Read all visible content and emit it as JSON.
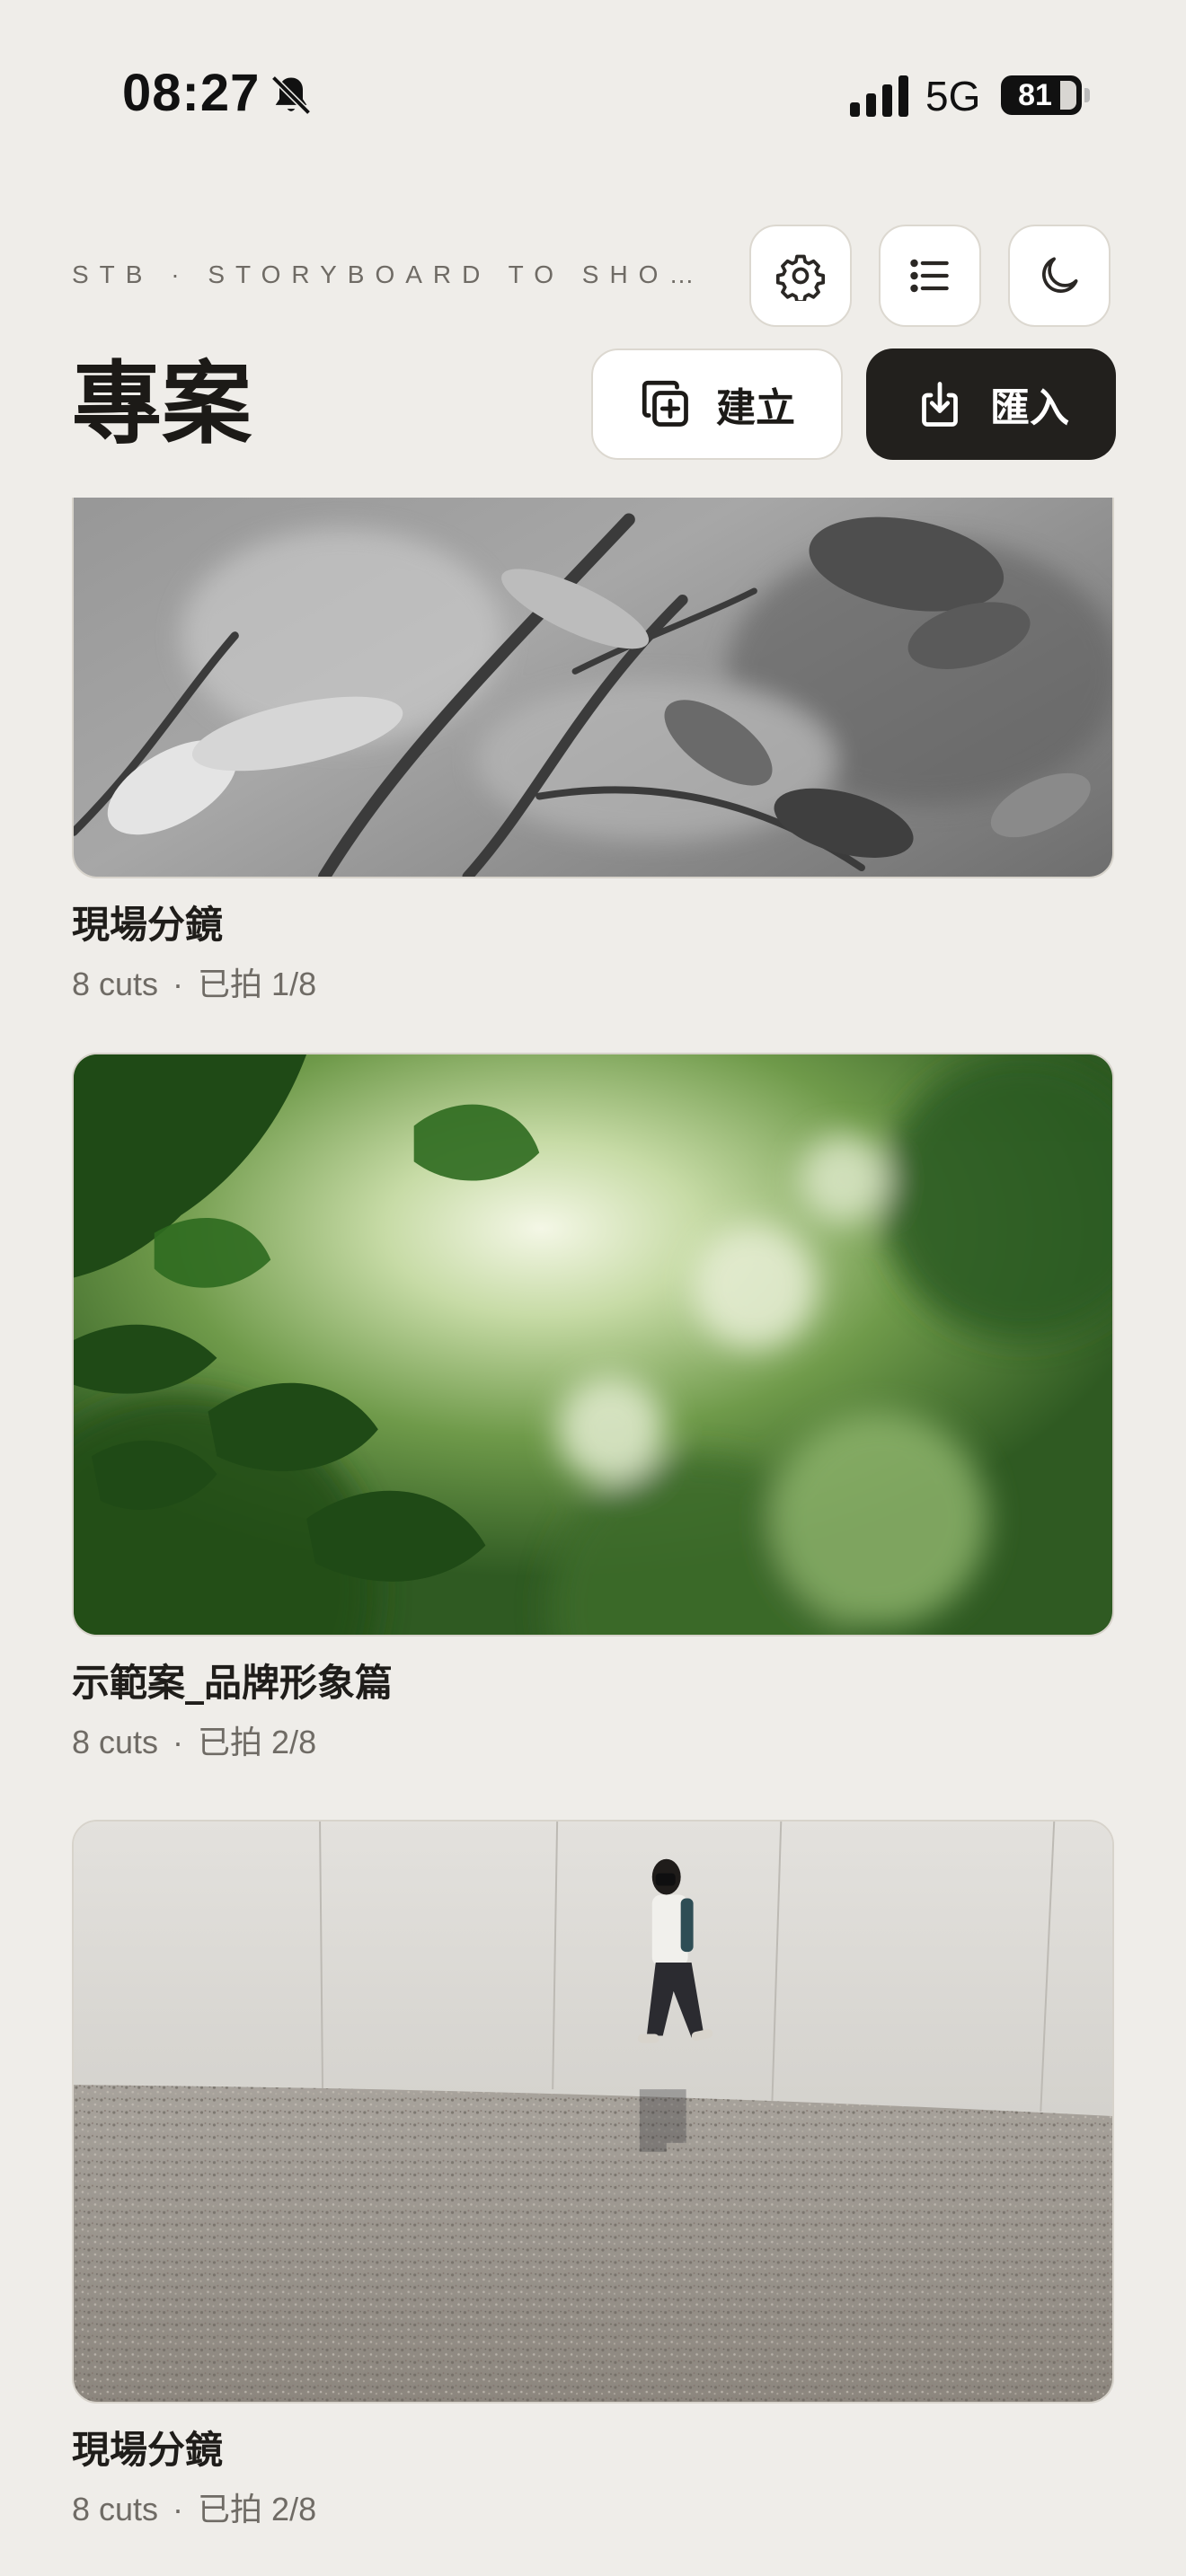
{
  "status_bar": {
    "time": "08:27",
    "network": "5G",
    "battery": "81"
  },
  "header": {
    "subtitle": "STB · STORYBOARD TO SHO…",
    "title": "專案",
    "create_label": "建立",
    "import_label": "匯入"
  },
  "icons": {
    "settings": "gear-icon",
    "list": "list-icon",
    "theme": "moon-icon",
    "create": "add-copy-icon",
    "import": "download-icon"
  },
  "colors": {
    "background": "#efede9",
    "primary_button": "#22201d",
    "muted_text": "#6f6b65"
  },
  "projects": [
    {
      "name": "現場分鏡",
      "cuts": "8 cuts",
      "separator": "·",
      "shot": "已拍 1/8"
    },
    {
      "name": "示範案_品牌形象篇",
      "cuts": "8 cuts",
      "separator": "·",
      "shot": "已拍 2/8"
    },
    {
      "name": "現場分鏡",
      "cuts": "8 cuts",
      "separator": "·",
      "shot": "已拍 2/8"
    }
  ]
}
